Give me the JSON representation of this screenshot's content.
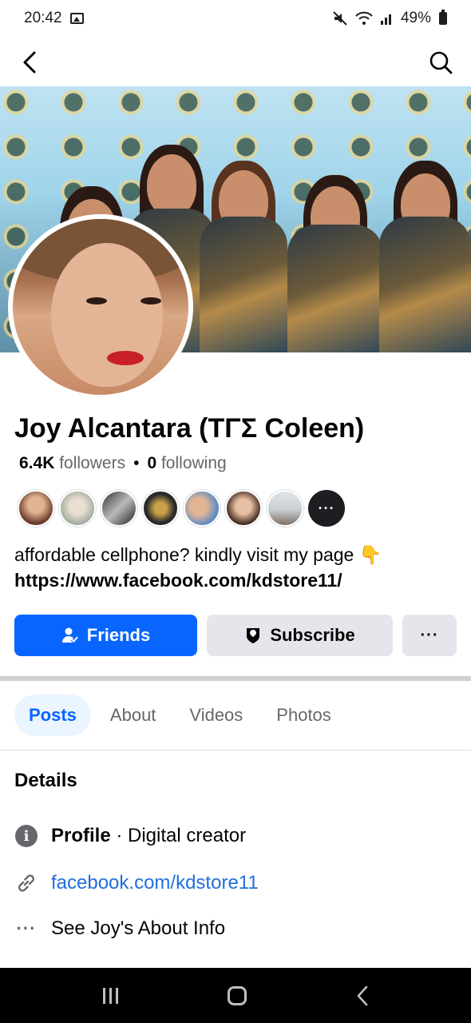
{
  "status_bar": {
    "time": "20:42",
    "battery": "49%",
    "icons": [
      "gallery-icon",
      "mute-icon",
      "wifi-icon",
      "signal-icon",
      "battery-icon"
    ]
  },
  "nav": {
    "back_icon": "back-arrow-icon",
    "search_icon": "search-icon"
  },
  "profile": {
    "name": "Joy Alcantara (ΤΓΣ Coleen)",
    "followers_count": "6.4K",
    "followers_label": "followers",
    "following_count": "0",
    "following_label": "following",
    "separator": "•",
    "bio_text": "affordable cellphone? kindly visit my page",
    "bio_emoji": "👇",
    "bio_link": "https://www.facebook.com/kdstore11/"
  },
  "friend_avatars": {
    "count_shown": 7,
    "more_label": "···"
  },
  "actions": {
    "friends_label": "Friends",
    "subscribe_label": "Subscribe",
    "more_label": "···"
  },
  "tabs": [
    {
      "label": "Posts",
      "active": true
    },
    {
      "label": "About",
      "active": false
    },
    {
      "label": "Videos",
      "active": false
    },
    {
      "label": "Photos",
      "active": false
    }
  ],
  "details": {
    "title": "Details",
    "profile_label": "Profile",
    "profile_separator": " · ",
    "profile_category": "Digital creator",
    "link": "facebook.com/kdstore11",
    "about_link": "See Joy's About Info"
  },
  "colors": {
    "accent": "#0866ff",
    "link": "#216fdb",
    "secondary_button": "#e4e6eb",
    "secondary_text": "#65676b"
  }
}
